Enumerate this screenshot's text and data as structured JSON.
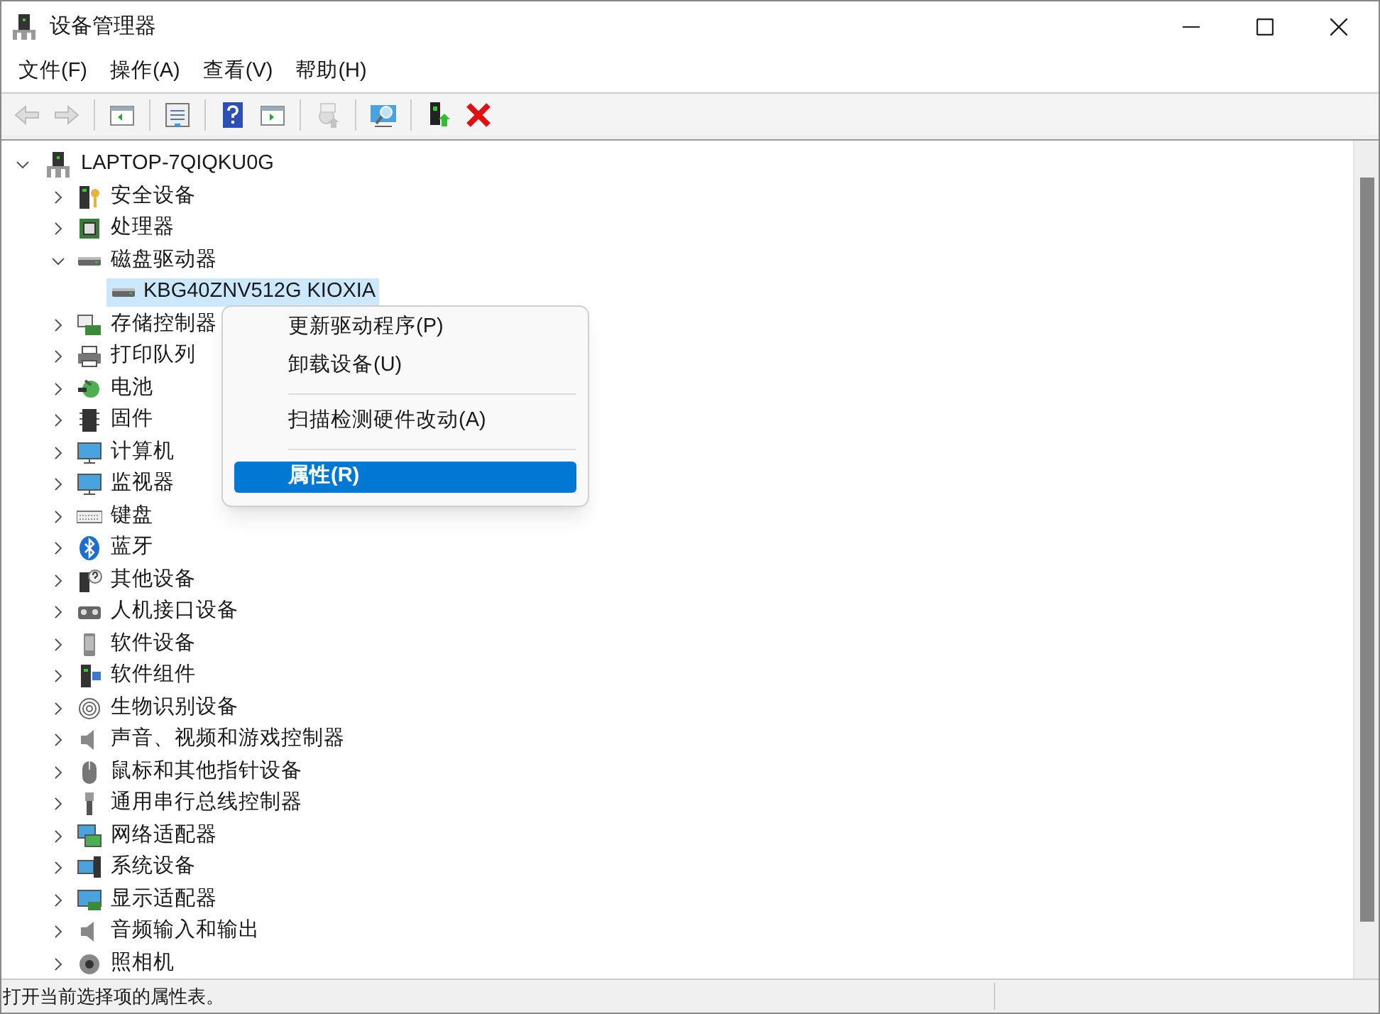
{
  "window": {
    "title": "设备管理器"
  },
  "menu_bar": [
    "文件(F)",
    "操作(A)",
    "查看(V)",
    "帮助(H)"
  ],
  "toolbar": [
    {
      "kind": "back",
      "disabled": true
    },
    {
      "kind": "forward",
      "disabled": true
    },
    {
      "kind": "separator"
    },
    {
      "kind": "console-tree",
      "disabled": false
    },
    {
      "kind": "separator"
    },
    {
      "kind": "properties",
      "disabled": false
    },
    {
      "kind": "separator"
    },
    {
      "kind": "help",
      "disabled": false
    },
    {
      "kind": "action-pane",
      "disabled": false
    },
    {
      "kind": "separator"
    },
    {
      "kind": "update-driver",
      "disabled": true
    },
    {
      "kind": "separator"
    },
    {
      "kind": "scan",
      "disabled": false
    },
    {
      "kind": "separator"
    },
    {
      "kind": "enable",
      "disabled": false
    },
    {
      "kind": "uninstall",
      "disabled": false
    }
  ],
  "tree": {
    "label": "LAPTOP-7QIQKU0G",
    "expanded": true,
    "children": [
      {
        "label": "安全设备",
        "expanded": false
      },
      {
        "label": "处理器",
        "expanded": false
      },
      {
        "label": "磁盘驱动器",
        "expanded": true,
        "children": [
          {
            "label": "KBG40ZNV512G KIOXIA",
            "selected": true
          }
        ]
      },
      {
        "label": "存储控制器",
        "expanded": false
      },
      {
        "label": "打印队列",
        "expanded": false
      },
      {
        "label": "电池",
        "expanded": false
      },
      {
        "label": "固件",
        "expanded": false
      },
      {
        "label": "计算机",
        "expanded": false
      },
      {
        "label": "监视器",
        "expanded": false
      },
      {
        "label": "键盘",
        "expanded": false
      },
      {
        "label": "蓝牙",
        "expanded": false
      },
      {
        "label": "其他设备",
        "expanded": false
      },
      {
        "label": "人机接口设备",
        "expanded": false
      },
      {
        "label": "软件设备",
        "expanded": false
      },
      {
        "label": "软件组件",
        "expanded": false
      },
      {
        "label": "生物识别设备",
        "expanded": false
      },
      {
        "label": "声音、视频和游戏控制器",
        "expanded": false
      },
      {
        "label": "鼠标和其他指针设备",
        "expanded": false
      },
      {
        "label": "通用串行总线控制器",
        "expanded": false
      },
      {
        "label": "网络适配器",
        "expanded": false
      },
      {
        "label": "系统设备",
        "expanded": false
      },
      {
        "label": "显示适配器",
        "expanded": false
      },
      {
        "label": "音频输入和输出",
        "expanded": false
      },
      {
        "label": "照相机",
        "expanded": false
      }
    ]
  },
  "context_menu": [
    {
      "kind": "item",
      "label": "更新驱动程序(P)",
      "selected": false
    },
    {
      "kind": "item",
      "label": "卸载设备(U)",
      "selected": false
    },
    {
      "kind": "separator"
    },
    {
      "kind": "item",
      "label": "扫描检测硬件改动(A)",
      "selected": false
    },
    {
      "kind": "separator"
    },
    {
      "kind": "item",
      "label": "属性(R)",
      "selected": true
    }
  ],
  "status_bar": "打开当前选择项的属性表。"
}
